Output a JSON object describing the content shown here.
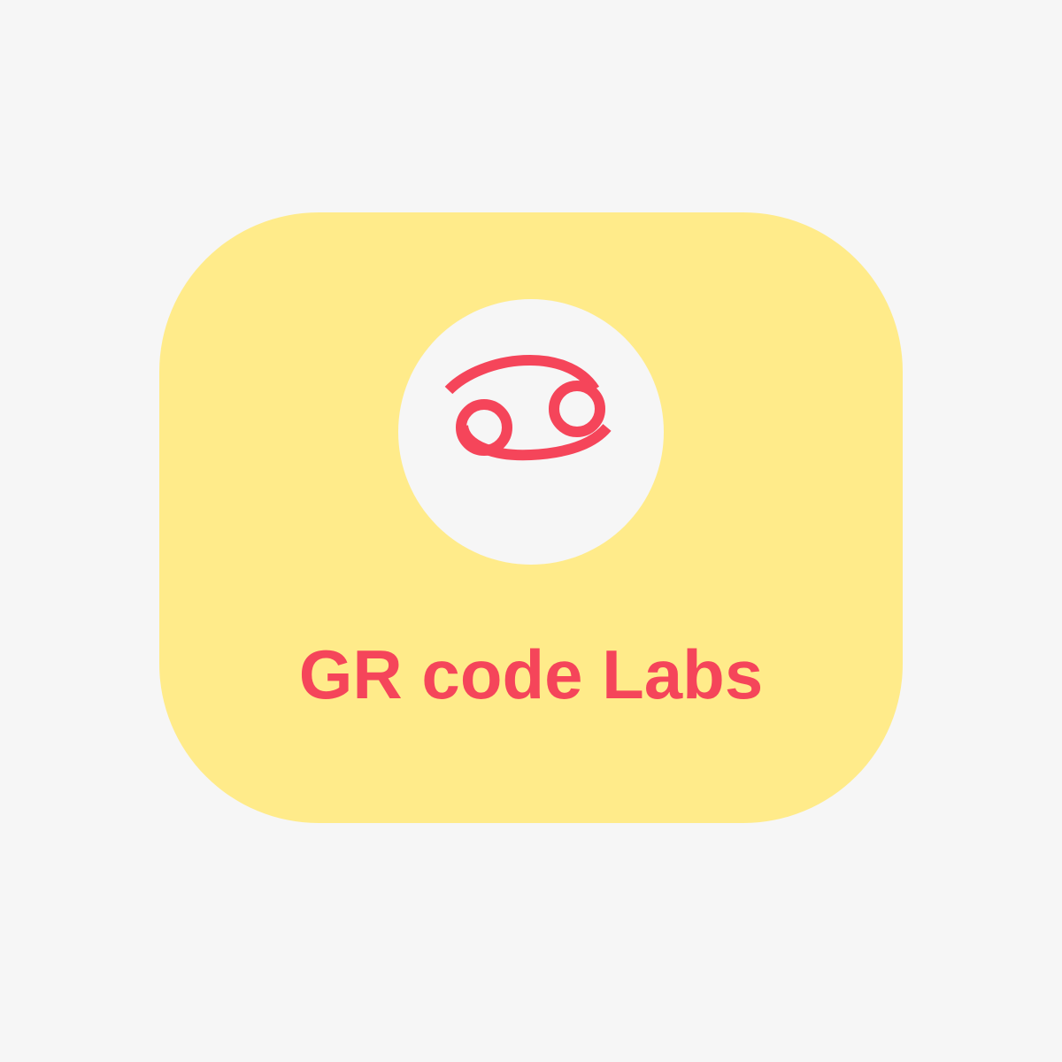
{
  "logo": {
    "brand_name": "GR code Labs",
    "icon": "cancer-zodiac-icon",
    "colors": {
      "background": "#f6f6f6",
      "card": "#ffeb8a",
      "emblem_circle": "#f6f6f6",
      "accent": "#f5455a"
    }
  }
}
